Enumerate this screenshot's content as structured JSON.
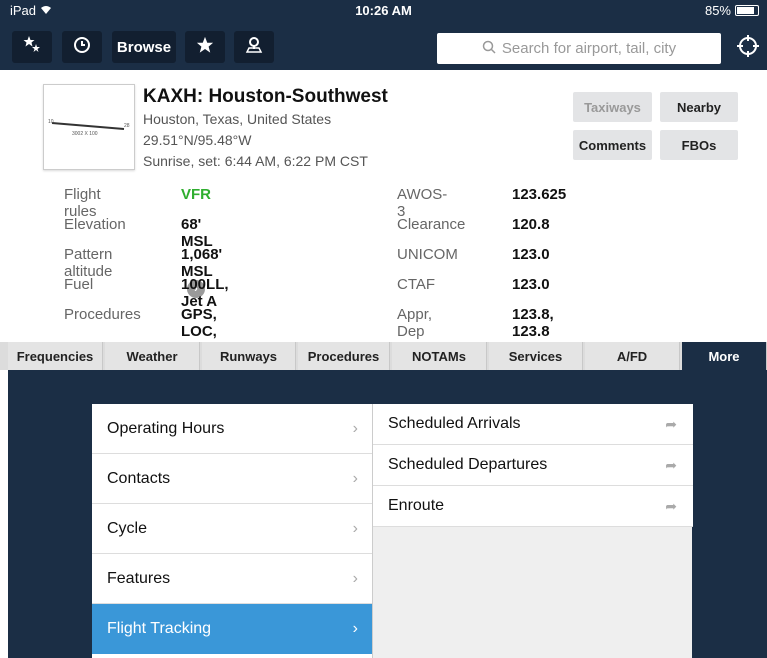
{
  "status_bar": {
    "device": "iPad",
    "time": "10:26 AM",
    "battery": "85%",
    "battery_level": 0.85
  },
  "toolbar": {
    "browse_label": "Browse",
    "search_placeholder": "Search for airport, tail, city"
  },
  "airport": {
    "title": "KAXH: Houston-Southwest",
    "location": "Houston, Texas, United States",
    "coords": "29.51°N/95.48°W",
    "sun": "Sunrise, set: 6:44 AM, 6:22 PM CST",
    "buttons": {
      "taxiways": "Taxiways",
      "nearby": "Nearby",
      "comments": "Comments",
      "fbos": "FBOs"
    }
  },
  "info_left": [
    {
      "label": "Flight rules",
      "value": "VFR"
    },
    {
      "label": "Elevation",
      "value": "68' MSL"
    },
    {
      "label": "Pattern altitude",
      "value": "1,068' MSL"
    },
    {
      "label": "Fuel",
      "value": "100LL, Jet A"
    },
    {
      "label": "Procedures",
      "value": "GPS, LOC, RNAV"
    }
  ],
  "info_right": [
    {
      "label": "AWOS-3",
      "value": "123.625"
    },
    {
      "label": "Clearance",
      "value": "120.8"
    },
    {
      "label": "UNICOM",
      "value": "123.0"
    },
    {
      "label": "CTAF",
      "value": "123.0"
    },
    {
      "label": "Appr, Dep",
      "value": "123.8, 123.8"
    }
  ],
  "tabs": [
    "Frequencies",
    "Weather",
    "Runways",
    "Procedures",
    "NOTAMs",
    "Services",
    "A/FD",
    "More"
  ],
  "menu_left": [
    "Operating Hours",
    "Contacts",
    "Cycle",
    "Features",
    "Flight Tracking"
  ],
  "menu_right": [
    "Scheduled Arrivals",
    "Scheduled Departures",
    "Enroute"
  ],
  "colors": {
    "nav": "#1b2e45",
    "selected": "#3a97d8",
    "vfr": "#2fae2f"
  }
}
